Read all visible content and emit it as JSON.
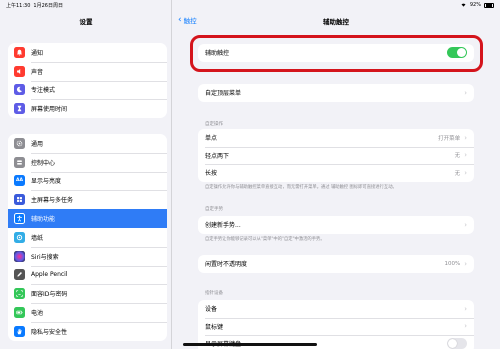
{
  "status": {
    "time": "上午11:30",
    "date": "1月26日周日",
    "battery": "92%"
  },
  "sidebar": {
    "title": "设置",
    "groups": [
      [
        {
          "label": "通知",
          "icon": "bell-icon",
          "color": "#ff3b30"
        },
        {
          "label": "声音",
          "icon": "speaker-icon",
          "color": "#ff3b30"
        },
        {
          "label": "专注模式",
          "icon": "moon-icon",
          "color": "#5e5ce6"
        },
        {
          "label": "屏幕使用时间",
          "icon": "hourglass-icon",
          "color": "#5e5ce6"
        }
      ],
      [
        {
          "label": "通用",
          "icon": "gear-icon",
          "color": "#8e8e93"
        },
        {
          "label": "控制中心",
          "icon": "control-center-icon",
          "color": "#8e8e93"
        },
        {
          "label": "显示与亮度",
          "icon": "brightness-icon",
          "color": "#0a7aff"
        },
        {
          "label": "主屏幕与多任务",
          "icon": "home-grid-icon",
          "color": "#3b5bdb"
        },
        {
          "label": "辅助功能",
          "icon": "accessibility-icon",
          "color": "#0a7aff"
        },
        {
          "label": "墙纸",
          "icon": "wallpaper-icon",
          "color": "#32ade6"
        },
        {
          "label": "Siri与搜索",
          "icon": "siri-icon",
          "color": "#222222"
        },
        {
          "label": "Apple Pencil",
          "icon": "pencil-icon",
          "color": "#555555"
        },
        {
          "label": "面容ID与密码",
          "icon": "faceid-icon",
          "color": "#34c759"
        },
        {
          "label": "电池",
          "icon": "battery-icon",
          "color": "#34c759"
        },
        {
          "label": "隐私与安全性",
          "icon": "hand-icon",
          "color": "#0a7aff"
        }
      ]
    ]
  },
  "nav": {
    "back": "触控",
    "title": "辅助触控"
  },
  "main": {
    "assistive_touch": {
      "label": "辅助触控",
      "on": true
    },
    "customize_menu": "自定顶层菜单",
    "custom_actions_header": "自定操作",
    "actions": [
      {
        "label": "单点",
        "value": "打开菜单"
      },
      {
        "label": "轻点两下",
        "value": "无"
      },
      {
        "label": "长按",
        "value": "无"
      }
    ],
    "actions_footer": "自定操作允许你与辅助触控菜单直接互动，而无需打开菜单。通过 辅助触控 图标即可直接进行互动。",
    "custom_gestures_header": "自定手势",
    "create_gesture": "创建新手势...",
    "gestures_footer": "自定手势让你能够记录可以从\"菜单\"中的\"自定\"中激活的手势。",
    "idle_opacity": {
      "label": "闲置时不透明度",
      "value": "100%"
    },
    "devices_header": "指针设备",
    "devices": [
      "设备",
      "鼠标键",
      "显示屏幕键盘"
    ]
  }
}
